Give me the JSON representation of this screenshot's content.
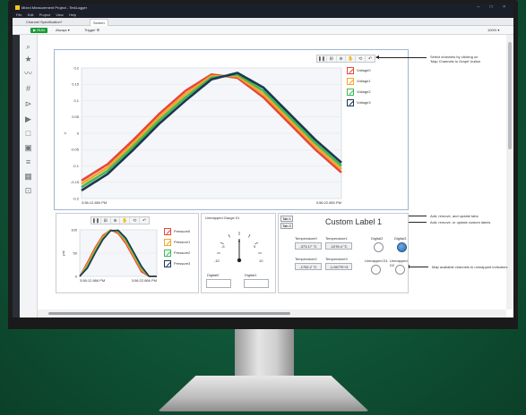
{
  "app": {
    "title": "Mixed Measurement Project - TestLogger",
    "window_buttons": "– □ ×"
  },
  "menu": [
    "File",
    "Edit",
    "Project",
    "View",
    "Help"
  ],
  "tabs": [
    {
      "label": "Channel Specification*"
    },
    {
      "label": "Screen"
    }
  ],
  "toolbar": {
    "run_label": "RUN",
    "mode_label": "Always",
    "trigger_label": "Trigger",
    "zoom_label": "100%"
  },
  "main_graph": {
    "toolbar_icons": [
      "pause-icon",
      "zoom-icon",
      "zoom-in-icon",
      "pan-icon",
      "reset-icon",
      "undo-icon"
    ],
    "legend": [
      "Voltage0",
      "Voltage1",
      "Voltage2",
      "Voltage3"
    ],
    "y_ticks": [
      "0.2",
      "0.15",
      "0.1",
      "0.05",
      "0",
      "-0.05",
      "-0.1",
      "-0.15",
      "-0.2"
    ],
    "x_ticks": [
      "3:56:12.850 PM",
      "3:56:22.850 PM"
    ],
    "ylabel": "V"
  },
  "chart_data": [
    {
      "type": "line",
      "xlabel": "",
      "ylabel": "V",
      "ylim": [
        -0.2,
        0.2
      ],
      "x_ticks": [
        "3:56:12.850 PM",
        "3:56:22.850 PM"
      ],
      "x": [
        0,
        1,
        2,
        3,
        4,
        5,
        6,
        7,
        8,
        9,
        10
      ],
      "series": [
        {
          "name": "Voltage0",
          "color": "#e8453c",
          "values": [
            -0.145,
            -0.095,
            -0.02,
            0.06,
            0.13,
            0.18,
            0.17,
            0.11,
            0.03,
            -0.05,
            -0.12
          ]
        },
        {
          "name": "Voltage1",
          "color": "#f5a623",
          "values": [
            -0.155,
            -0.105,
            -0.03,
            0.05,
            0.12,
            0.175,
            0.175,
            0.12,
            0.04,
            -0.04,
            -0.11
          ]
        },
        {
          "name": "Voltage2",
          "color": "#3db858",
          "values": [
            -0.165,
            -0.115,
            -0.04,
            0.04,
            0.11,
            0.17,
            0.18,
            0.13,
            0.05,
            -0.03,
            -0.1
          ]
        },
        {
          "name": "Voltage3",
          "color": "#1f3550",
          "values": [
            -0.175,
            -0.125,
            -0.05,
            0.03,
            0.1,
            0.165,
            0.185,
            0.14,
            0.06,
            -0.02,
            -0.09
          ]
        }
      ]
    },
    {
      "type": "line",
      "xlabel": "",
      "ylabel": "psi",
      "ylim": [
        0,
        100
      ],
      "x_ticks": [
        "3:56:12.866 PM",
        "3:56:22.866 PM"
      ],
      "x": [
        0,
        1,
        2,
        3,
        4,
        5,
        6,
        7,
        8,
        9,
        10
      ],
      "series": [
        {
          "name": "Pressure0",
          "color": "#e8453c",
          "values": [
            0,
            30,
            62,
            88,
            100,
            92,
            70,
            40,
            10,
            0,
            0
          ]
        },
        {
          "name": "Pressure1",
          "color": "#f5a623",
          "values": [
            0,
            26,
            58,
            85,
            100,
            95,
            74,
            44,
            14,
            0,
            0
          ]
        },
        {
          "name": "Pressure2",
          "color": "#3db858",
          "values": [
            0,
            22,
            54,
            82,
            99,
            97,
            78,
            48,
            18,
            0,
            0
          ]
        },
        {
          "name": "Pressure3",
          "color": "#1f3550",
          "values": [
            0,
            18,
            50,
            79,
            98,
            99,
            82,
            52,
            22,
            0,
            0
          ]
        }
      ]
    }
  ],
  "small_graph": {
    "legend": [
      "Pressure0",
      "Pressure1",
      "Pressure2",
      "Pressure3"
    ],
    "y_ticks": [
      "100",
      "50",
      "0"
    ],
    "x_ticks": [
      "3:56:12.866 PM",
      "3:56:22.866 PM"
    ],
    "ylabel": "psi"
  },
  "gauge": {
    "title": "Unmapped Gauge 01",
    "ticks": [
      "0",
      "5",
      "10",
      "-5",
      "-10"
    ],
    "digital0": "Digital0",
    "digital1": "Digital1"
  },
  "tabs_panel": {
    "tab1": "Tab 1",
    "tab2": "Tab 2",
    "custom_label": "Custom Label 1",
    "temp0_label": "Temperature0",
    "temp0_value": "-373.17 °C",
    "temp1_label": "Temperature1",
    "temp1_value": "-1076.4 °C",
    "temp2_label": "Temperature2",
    "temp2_value": "-1752.2 °C",
    "temp3_label": "Temperature3",
    "temp3_value": "-1.0677E+3",
    "dig2": "Digital2",
    "dig3": "Digital3",
    "unmapped_d1": "Unmapped D1",
    "unmapped_d2": "Unmapped D2"
  },
  "annotations": {
    "a1_line1": "Select channels by clicking on",
    "a1_line2": "'Map Channels to Graph' button",
    "a2": "Add, remove, and update tabs",
    "a3": "Add, remove, or update custom labels",
    "a4": "Map available channels to unmapped indicators"
  }
}
